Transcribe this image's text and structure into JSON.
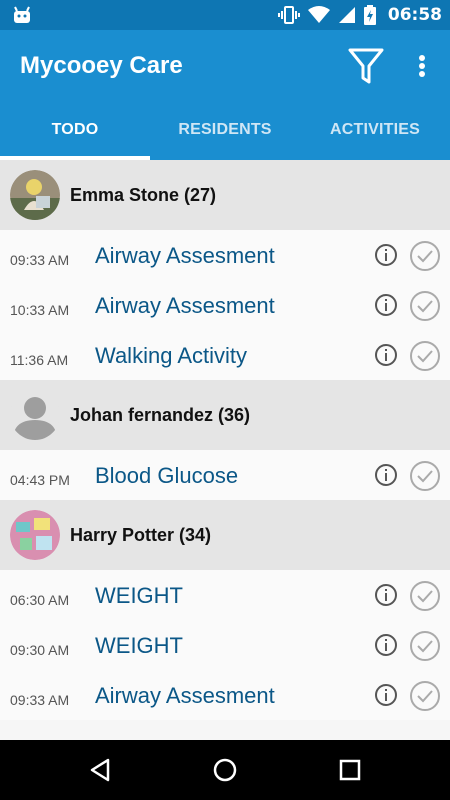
{
  "status_bar": {
    "time": "06:58"
  },
  "app": {
    "title": "Mycooey Care"
  },
  "tabs": [
    {
      "label": "TODO",
      "active": true
    },
    {
      "label": "RESIDENTS",
      "active": false
    },
    {
      "label": "ACTIVITIES",
      "active": false
    }
  ],
  "colors": {
    "primary": "#1a8ed0",
    "status_bar": "#0e76b3",
    "task_text": "#0b5787"
  },
  "groups": [
    {
      "resident": "Emma Stone (27)",
      "avatar": "photo-avatar",
      "tasks": [
        {
          "time": "09:33 AM",
          "name": "Airway Assesment"
        },
        {
          "time": "10:33 AM",
          "name": "Airway Assesment"
        },
        {
          "time": "11:36 AM",
          "name": "Walking Activity"
        }
      ]
    },
    {
      "resident": "Johan fernandez (36)",
      "avatar": "default-person-avatar",
      "tasks": [
        {
          "time": "04:43 PM",
          "name": "Blood Glucose"
        }
      ]
    },
    {
      "resident": "Harry Potter (34)",
      "avatar": "photo-avatar",
      "tasks": [
        {
          "time": "06:30 AM",
          "name": "WEIGHT"
        },
        {
          "time": "09:30 AM",
          "name": "WEIGHT"
        },
        {
          "time": "09:33 AM",
          "name": "Airway Assesment"
        }
      ]
    }
  ]
}
